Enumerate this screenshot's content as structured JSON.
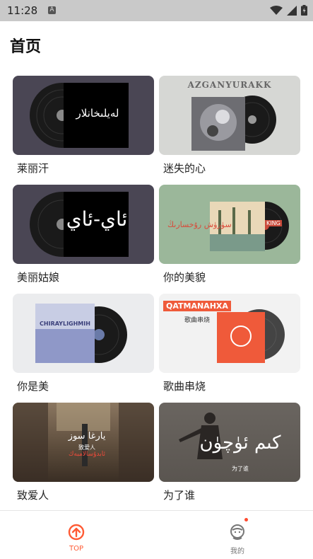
{
  "status": {
    "time": "11:28",
    "a_icon": "A"
  },
  "page": {
    "title": "首页"
  },
  "cards": [
    {
      "label": "莱丽汗",
      "cover_text": "لەيلىخانلار"
    },
    {
      "label": "迷失的心",
      "cover_text": "AZGANYURAKK"
    },
    {
      "label": "美丽姑娘",
      "cover_text": "ئاي-ئاي"
    },
    {
      "label": "你的美貌",
      "cover_text": "سۈرۈش رۇخسارىڭ",
      "badge": "KING"
    },
    {
      "label": "你是美",
      "cover_text": "CHIRAYLIGHMIH"
    },
    {
      "label": "歌曲串烧",
      "cover_text": "QATMANAHXA",
      "cover_sub": "歌曲串烧"
    },
    {
      "label": "致爱人",
      "cover_text": "يارغا سوز",
      "cover_sub": "致爱人",
      "cover_sub2": "ئابدۇسالامبەك"
    },
    {
      "label": "为了谁",
      "cover_text": "كىم ئۈچۈن",
      "cover_sub": "为了谁"
    }
  ],
  "nav": {
    "top_label": "TOP",
    "me_label": "我的"
  },
  "colors": {
    "accent": "#ff5a34",
    "nav_inactive": "#777777"
  }
}
